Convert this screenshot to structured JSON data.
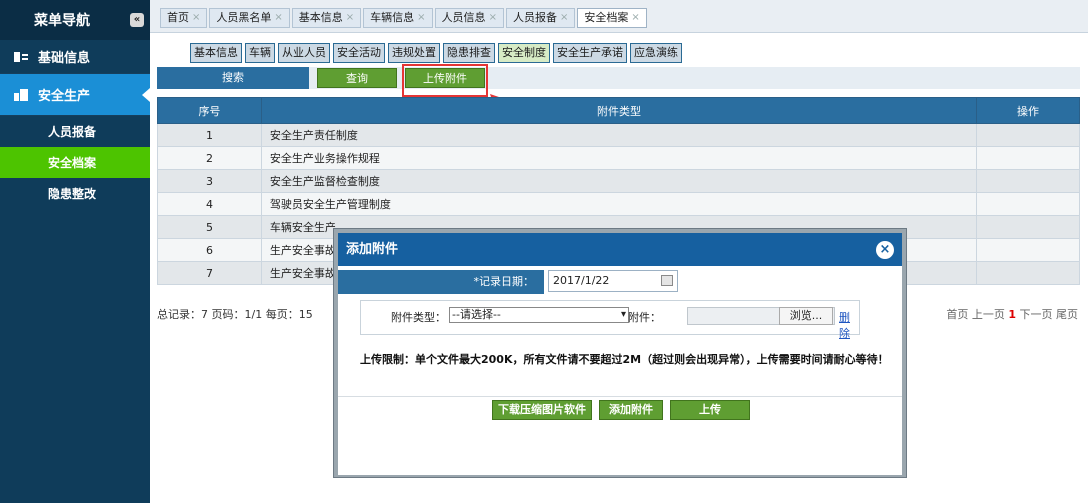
{
  "sidebar": {
    "title": "菜单导航",
    "collapse_glyph": "«",
    "sections": [
      {
        "label": "基础信息",
        "icon": "id-card-icon"
      },
      {
        "label": "安全生产",
        "icon": "building-icon"
      }
    ],
    "items": [
      "人员报备",
      "安全档案",
      "隐患整改"
    ],
    "active_item": "安全档案"
  },
  "tabs": [
    {
      "label": "首页"
    },
    {
      "label": "人员黑名单"
    },
    {
      "label": "基本信息"
    },
    {
      "label": "车辆信息"
    },
    {
      "label": "人员信息"
    },
    {
      "label": "人员报备"
    },
    {
      "label": "安全档案"
    }
  ],
  "active_tab": "安全档案",
  "subnav": [
    "基本信息",
    "车辆",
    "从业人员",
    "安全活动",
    "违规处置",
    "隐患排查",
    "安全制度",
    "安全生产承诺",
    "应急演练"
  ],
  "active_subnav": "安全制度",
  "toolbar": {
    "search": "搜索",
    "query": "查询",
    "upload": "上传附件"
  },
  "table": {
    "headers": [
      "序号",
      "附件类型",
      "操作"
    ],
    "rows": [
      {
        "no": "1",
        "type": "安全生产责任制度"
      },
      {
        "no": "2",
        "type": "安全生产业务操作规程"
      },
      {
        "no": "3",
        "type": "安全生产监督检查制度"
      },
      {
        "no": "4",
        "type": "驾驶员安全生产管理制度"
      },
      {
        "no": "5",
        "type": "车辆安全生产"
      },
      {
        "no": "6",
        "type": "生产安全事故"
      },
      {
        "no": "7",
        "type": "生产安全事故"
      }
    ]
  },
  "summary": "总记录：7 页码：1/1 每页：15",
  "pager": {
    "first": "首页",
    "prev": "上一页",
    "current": "1",
    "next": "下一页",
    "last": "尾页"
  },
  "dialog": {
    "title": "添加附件",
    "date_label": "*记录日期：",
    "date_value": "2017/1/22",
    "type_label": "附件类型：",
    "type_selected": "--请选择--",
    "attach_label": "附件：",
    "browse": "浏览...",
    "delete": "删除",
    "limit_text": "上传限制：单个文件最大200K，所有文件请不要超过2M（超过则会出现异常），上传需要时间请耐心等待！",
    "btn_download": "下载压缩图片软件",
    "btn_add": "添加附件",
    "btn_upload": "上传"
  },
  "colors": {
    "sidebar": "#0f3c5a",
    "accent_blue": "#1b8fd6",
    "active_green": "#4dc400",
    "button_green": "#5f9e32",
    "highlight": "#e53535"
  }
}
